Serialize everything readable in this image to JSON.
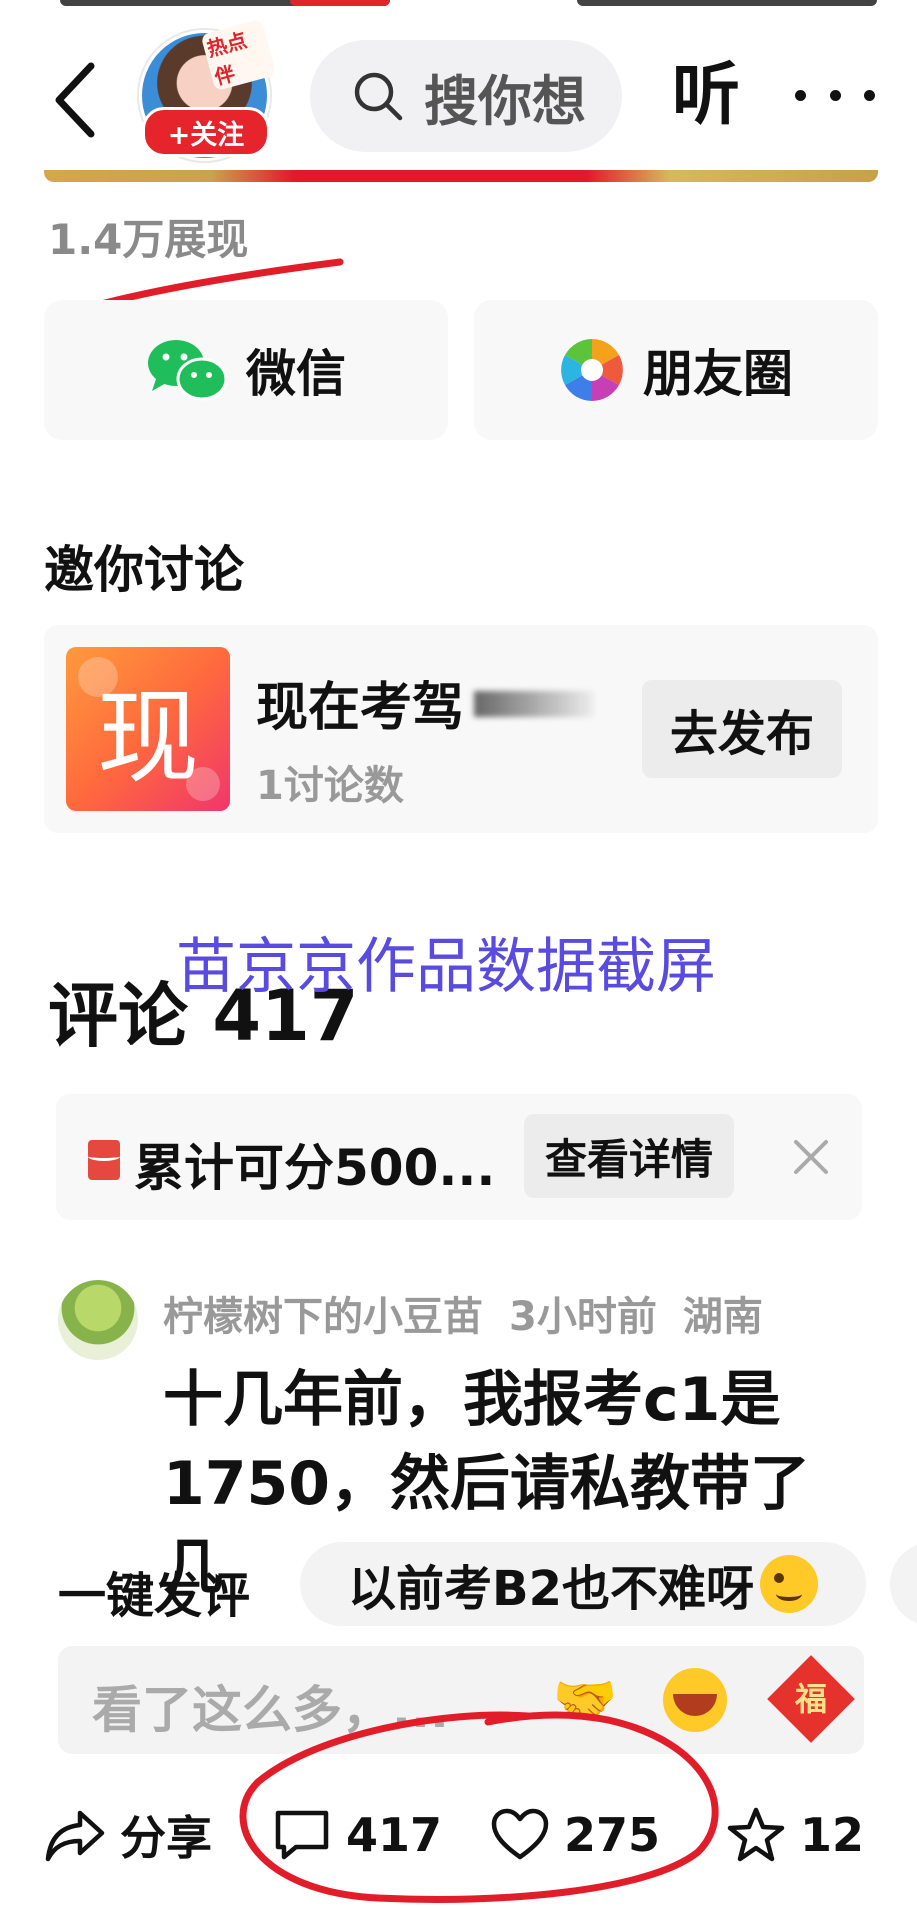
{
  "header": {
    "avatar_badge": "热点伴",
    "follow_label": "+关注",
    "search_placeholder": "搜你想",
    "listen_label": "听"
  },
  "post": {
    "views": "1.4万展现"
  },
  "share": {
    "wechat_label": "微信",
    "moments_label": "朋友圈"
  },
  "invite": {
    "title": "邀你讨论",
    "topic_icon_char": "现",
    "topic_title": "现在考驾",
    "topic_count": "1讨论数",
    "publish_label": "去发布"
  },
  "watermark": "苗京京作品数据截屏",
  "comments": {
    "title": "评论 417",
    "notice_text": "累计可分500...",
    "notice_button": "查看详情",
    "items": [
      {
        "user": "柠檬树下的小豆苗",
        "time": "3小时前",
        "location": "湖南",
        "text": "十几年前，我报考c1是1750，然后请私教带了几"
      }
    ]
  },
  "quick_reply": {
    "label": "一键发评",
    "chip": "以前考B2也不难呀"
  },
  "input": {
    "placeholder": "看了这么多，...",
    "fu_char": "福"
  },
  "bottom_bar": {
    "share_label": "分享",
    "comment_count": "417",
    "like_count": "275",
    "favorite_count": "12"
  },
  "colors": {
    "accent_red": "#e5242c",
    "watermark_blue": "#5a4be0",
    "annotation_red": "#e21d2a"
  }
}
